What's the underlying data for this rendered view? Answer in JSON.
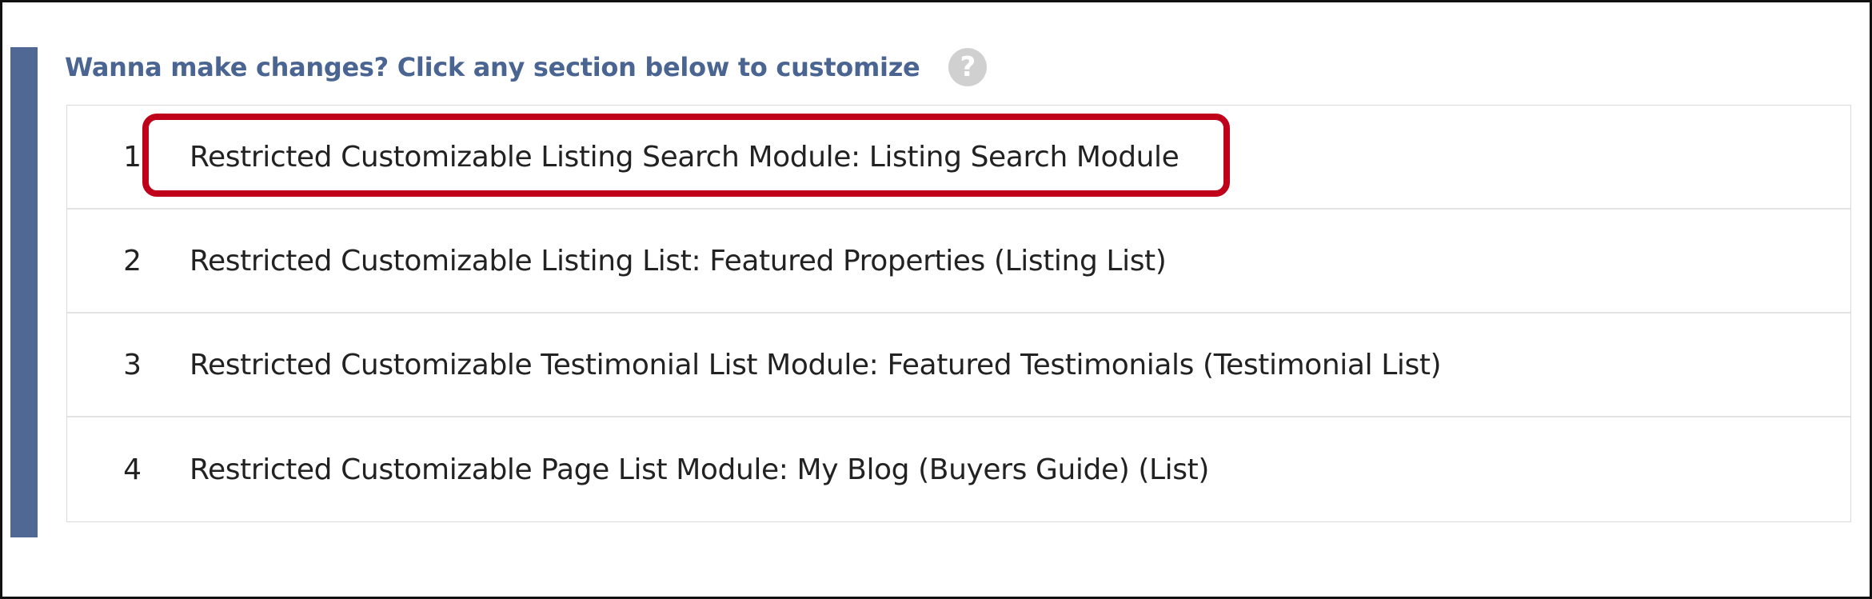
{
  "header": {
    "title": "Wanna make changes? Click any section below to customize",
    "help_icon": "?"
  },
  "modules": [
    {
      "index": "1",
      "label": "Restricted Customizable Listing Search Module: Listing Search Module",
      "highlighted": true
    },
    {
      "index": "2",
      "label": "Restricted Customizable Listing List: Featured Properties (Listing List)",
      "highlighted": false
    },
    {
      "index": "3",
      "label": "Restricted Customizable Testimonial List Module: Featured Testimonials (Testimonial List)",
      "highlighted": false
    },
    {
      "index": "4",
      "label": "Restricted Customizable Page List Module: My Blog (Buyers Guide) (List)",
      "highlighted": false
    }
  ],
  "colors": {
    "accent_bar": "#4f6994",
    "heading": "#4a6591",
    "highlight_border": "#c0001a",
    "help_icon_bg": "#d0d0d0"
  }
}
